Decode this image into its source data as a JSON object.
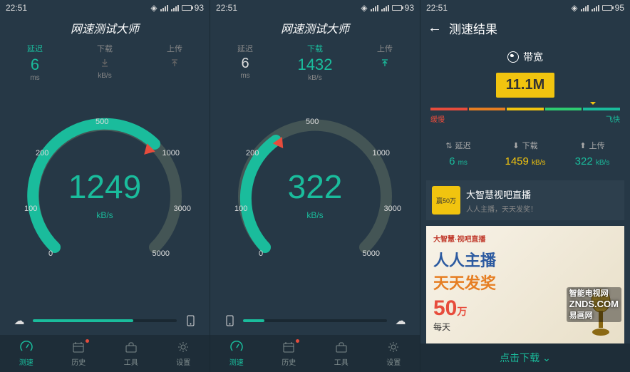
{
  "screens": [
    {
      "status": {
        "time": "22:51",
        "battery": "93"
      },
      "title": "网速测试大师",
      "stats": {
        "latency": {
          "label": "延迟",
          "value": "6",
          "unit": "ms",
          "active": true
        },
        "download": {
          "label": "下载",
          "value": "",
          "unit": "kB/s",
          "active": false
        },
        "upload": {
          "label": "上传",
          "value": "",
          "unit": "",
          "active": false
        }
      },
      "gauge": {
        "value": "1249",
        "unit": "kB/s",
        "ticks": [
          "0",
          "100",
          "200",
          "500",
          "1000",
          "3000",
          "5000"
        ],
        "pct": 0.55,
        "needle_deg": 45
      },
      "progress": {
        "pct": 70,
        "left_icon": "cloud",
        "right_icon": "phone"
      },
      "nav": [
        {
          "label": "测速",
          "icon": "gauge",
          "active": true,
          "dot": false
        },
        {
          "label": "历史",
          "icon": "calendar",
          "active": false,
          "dot": true
        },
        {
          "label": "工具",
          "icon": "toolbox",
          "active": false,
          "dot": false
        },
        {
          "label": "设置",
          "icon": "gear",
          "active": false,
          "dot": false
        }
      ]
    },
    {
      "status": {
        "time": "22:51",
        "battery": "93"
      },
      "title": "网速测试大师",
      "stats": {
        "latency": {
          "label": "延迟",
          "value": "6",
          "unit": "ms",
          "active": false
        },
        "download": {
          "label": "下载",
          "value": "1432",
          "unit": "kB/s",
          "active": true
        },
        "upload": {
          "label": "上传",
          "value": "",
          "unit": "",
          "active": false
        }
      },
      "gauge": {
        "value": "322",
        "unit": "kB/s",
        "ticks": [
          "0",
          "100",
          "200",
          "500",
          "1000",
          "3000",
          "5000"
        ],
        "pct": 0.33,
        "needle_deg": -35
      },
      "progress": {
        "pct": 15,
        "left_icon": "phone",
        "right_icon": "cloud"
      },
      "nav": [
        {
          "label": "测速",
          "icon": "gauge",
          "active": true,
          "dot": false
        },
        {
          "label": "历史",
          "icon": "calendar",
          "active": false,
          "dot": true
        },
        {
          "label": "工具",
          "icon": "toolbox",
          "active": false,
          "dot": false
        },
        {
          "label": "设置",
          "icon": "gear",
          "active": false,
          "dot": false
        }
      ]
    },
    {
      "status": {
        "time": "22:51",
        "battery": "95"
      },
      "title": "测速结果",
      "bandwidth": {
        "label": "带宽",
        "value": "11.1",
        "unit": "M",
        "slow": "缓慢",
        "fast": "飞快"
      },
      "colors": [
        "#e74c3c",
        "#e67e22",
        "#f1c40f",
        "#2ecc71",
        "#1abc9c"
      ],
      "result_stats": {
        "latency": {
          "label": "延迟",
          "value": "6",
          "unit": "ms",
          "color": "#1abc9c"
        },
        "download": {
          "label": "下载",
          "value": "1459",
          "unit": "kB/s",
          "color": "#f1c40f"
        },
        "upload": {
          "label": "上传",
          "value": "322",
          "unit": "kB/s",
          "color": "#1abc9c"
        }
      },
      "ad_item": {
        "title": "大智慧视吧直播",
        "desc": "人人主播，天天发奖！"
      },
      "big_ad": {
        "logo": "大智慧·视吧直播",
        "line1": "人人主播",
        "line2": "天天发奖",
        "big": "50",
        "sub": "万",
        "bottom": "每天"
      },
      "overlay": {
        "l1": "智能电视网",
        "l2": "ZNDS.COM",
        "l3": "易画网"
      },
      "download_btn": "点击下载"
    }
  ]
}
